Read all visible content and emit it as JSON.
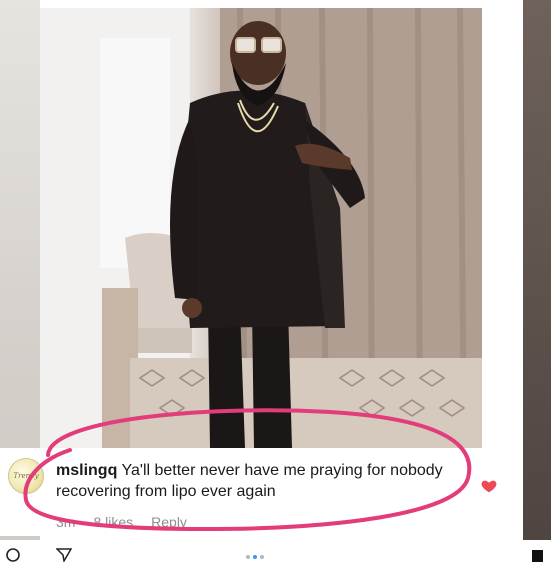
{
  "comment": {
    "username": "mslingq",
    "text": "Ya'll better never have me praying for nobody recovering from lipo ever again",
    "time": "3m",
    "likes": "8 likes",
    "reply": "Reply",
    "avatar_text": "Trendy"
  },
  "icons": {
    "like": "heart-icon",
    "comment": "comment-icon",
    "share": "send-icon",
    "save": "bookmark-icon"
  },
  "colors": {
    "highlight": "#e23d7a",
    "heart": "#ed4956",
    "muted": "#8e8e8e",
    "active_dot": "#3897f0"
  }
}
